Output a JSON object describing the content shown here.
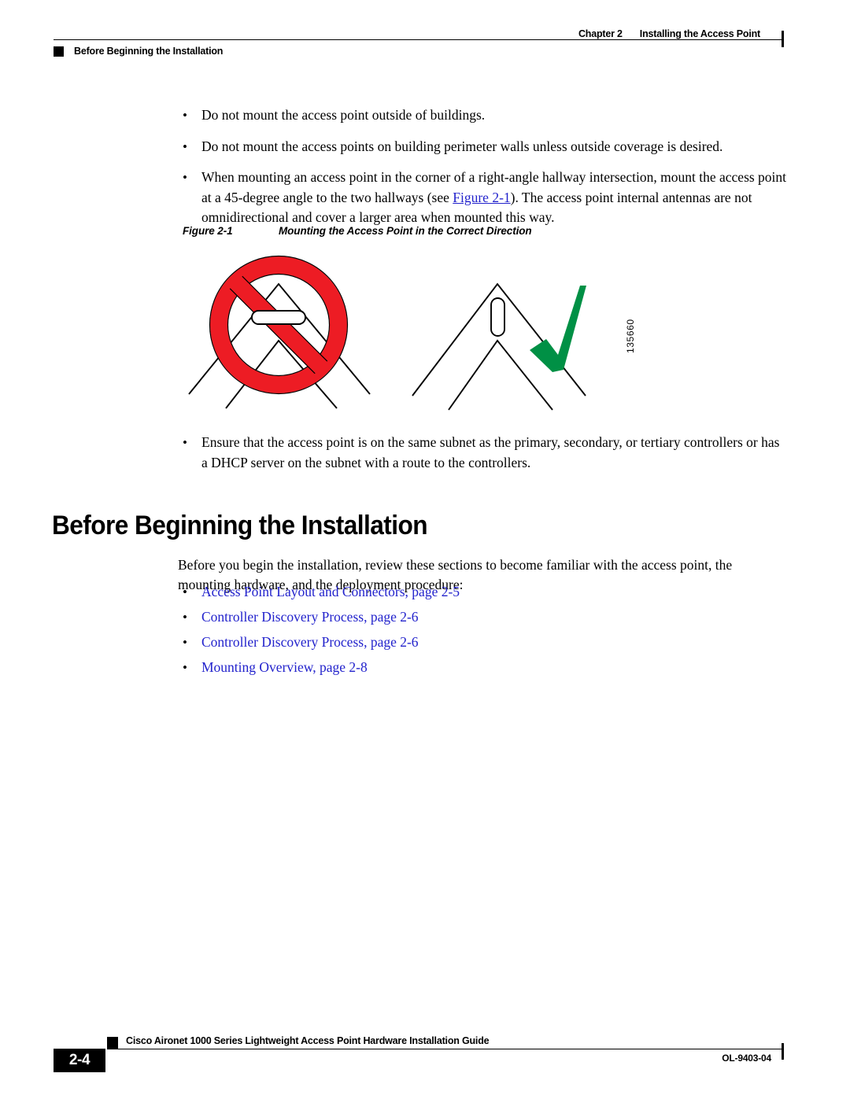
{
  "header": {
    "chapter_label": "Chapter 2",
    "chapter_title": "Installing the Access Point",
    "running_head": "Before Beginning the Installation"
  },
  "top_bullets": [
    {
      "marker": "•",
      "text": "Do not mount the access point outside of buildings."
    },
    {
      "marker": "•",
      "text": "Do not mount the access points on building perimeter walls unless outside coverage is desired."
    }
  ],
  "third_bullet": {
    "marker": "•",
    "part1": "When mounting an access point in the corner of a right-angle hallway intersection, mount the access point at a 45-degree angle to the two hallways (see ",
    "xref": "Figure 2-1",
    "part2": "). The access point internal antennas are not omnidirectional and cover a larger area when mounted this way."
  },
  "figure": {
    "caption_number": "Figure 2-1",
    "caption_title": "Mounting the Access Point in the Correct Direction",
    "figure_id": "135660",
    "colors": {
      "prohibition_red": "#ED1C24",
      "checkmark_green": "#009045",
      "line_black": "#000000"
    },
    "left_panel_name": "incorrect-mounting-diagram",
    "right_panel_name": "correct-mounting-diagram"
  },
  "subnet_bullet": {
    "marker": "•",
    "text": "Ensure that the access point is on the same subnet as the primary, secondary, or tertiary controllers or has a DHCP server on the subnet with a route to the controllers."
  },
  "section": {
    "heading": "Before Beginning the Installation",
    "intro": "Before you begin the installation, review these sections to become familiar with the access point, the mounting hardware, and the deployment procedure:",
    "links": [
      {
        "marker": "•",
        "text": "Access Point Layout and Connectors, page 2-5"
      },
      {
        "marker": "•",
        "text": "Controller Discovery Process, page 2-6"
      },
      {
        "marker": "•",
        "text": "Controller Discovery Process, page 2-6"
      },
      {
        "marker": "•",
        "text": "Mounting Overview, page 2-8"
      }
    ],
    "link_color": "#2222cc"
  },
  "footer": {
    "page_number": "2-4",
    "guide_title": "Cisco Aironet 1000 Series Lightweight Access Point Hardware Installation Guide",
    "doc_id": "OL-9403-04"
  }
}
